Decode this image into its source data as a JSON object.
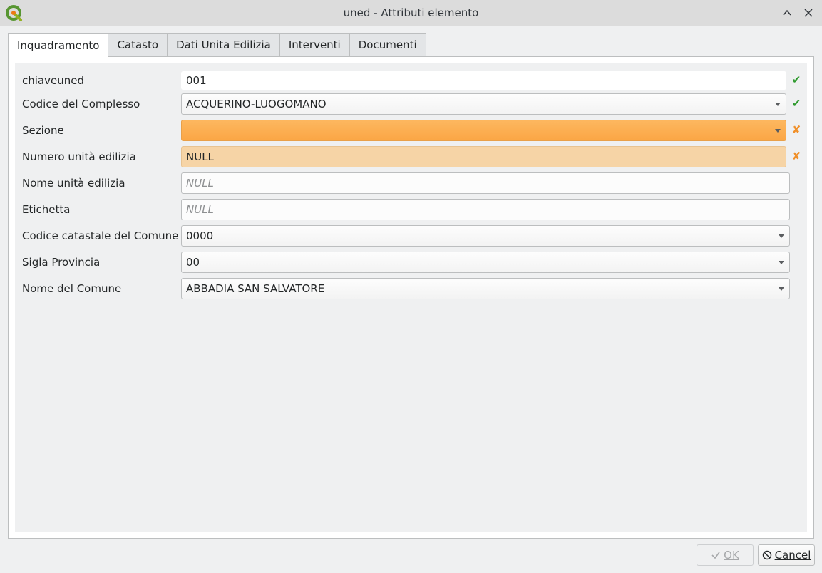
{
  "window": {
    "title": "uned - Attributi elemento"
  },
  "tabs": [
    {
      "label": "Inquadramento",
      "active": true
    },
    {
      "label": "Catasto",
      "active": false
    },
    {
      "label": "Dati Unita Edilizia",
      "active": false
    },
    {
      "label": "Interventi",
      "active": false
    },
    {
      "label": "Documenti",
      "active": false
    }
  ],
  "form": {
    "chiaveuned": {
      "label": "chiaveuned",
      "value": "001",
      "status": "✔"
    },
    "codice_complesso": {
      "label": "Codice del Complesso",
      "value": "ACQUERINO-LUOGOMANO",
      "status": "✔"
    },
    "sezione": {
      "label": "Sezione",
      "value": "",
      "status": "✘"
    },
    "numero_unita": {
      "label": "Numero unità edilizia",
      "value": "NULL",
      "status": "✘"
    },
    "nome_unita": {
      "label": "Nome unità edilizia",
      "placeholder": "NULL"
    },
    "etichetta": {
      "label": "Etichetta",
      "placeholder": "NULL"
    },
    "codice_catastale": {
      "label": "Codice catastale del Comune",
      "value": "0000"
    },
    "sigla_provincia": {
      "label": "Sigla Provincia",
      "value": "00"
    },
    "nome_comune": {
      "label": "Nome del Comune",
      "value": "ABBADIA SAN SALVATORE"
    }
  },
  "buttons": {
    "ok_label": "OK",
    "cancel_label": "Cancel"
  },
  "colors": {
    "valid": "#2e9a2e",
    "invalid": "#f0902a",
    "constraint_fail_fill": "#fba645",
    "constraint_warn_fill": "#f6d4a6"
  }
}
